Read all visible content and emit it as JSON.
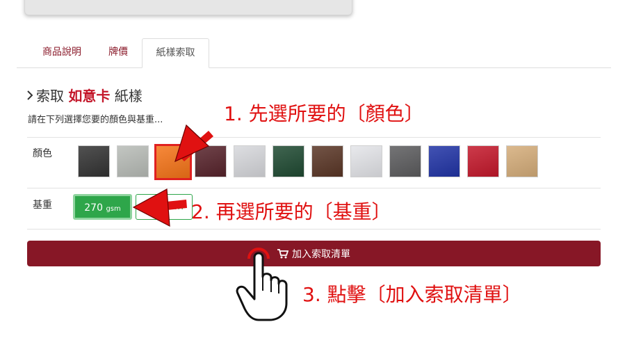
{
  "tabs": [
    {
      "label": "商品說明",
      "active": false
    },
    {
      "label": "牌價",
      "active": false
    },
    {
      "label": "紙樣索取",
      "active": true
    }
  ],
  "section": {
    "prefix": "索取",
    "product": "如意卡",
    "suffix": "紙樣",
    "hint": "請在下列選擇您要的顏色與基重..."
  },
  "color_row": {
    "label": "顏色",
    "swatches": [
      {
        "name": "black",
        "color": "#333333",
        "selected": false
      },
      {
        "name": "light-gray",
        "color": "#b8bcb7",
        "selected": false
      },
      {
        "name": "orange",
        "color": "#f57418",
        "selected": true
      },
      {
        "name": "burgundy",
        "color": "#57232b",
        "selected": false
      },
      {
        "name": "pale-gray",
        "color": "#d7d8dc",
        "selected": false
      },
      {
        "name": "dark-green",
        "color": "#1f4a32",
        "selected": false
      },
      {
        "name": "brown",
        "color": "#5a3626",
        "selected": false
      },
      {
        "name": "white-gray",
        "color": "#e4e5e9",
        "selected": false
      },
      {
        "name": "charcoal",
        "color": "#5c5c5e",
        "selected": false
      },
      {
        "name": "royal-blue",
        "color": "#2134a6",
        "selected": false
      },
      {
        "name": "red",
        "color": "#c4182b",
        "selected": false
      },
      {
        "name": "tan",
        "color": "#d5ad7a",
        "selected": false
      }
    ]
  },
  "weight_row": {
    "label": "基重",
    "options": [
      {
        "value": "270",
        "unit": "gsm",
        "active": true
      },
      {
        "value": "",
        "unit": "m",
        "active": false
      }
    ]
  },
  "add_button": {
    "label": "加入索取清單"
  },
  "annotations": {
    "step1": "1. 先選所要的〔顏色〕",
    "step2": "2. 再選所要的〔基重〕",
    "step3": "3.  點擊〔加入索取清單〕"
  },
  "colors": {
    "accent": "#871726",
    "annotation_red": "#e01111",
    "green": "#2ea64a"
  }
}
